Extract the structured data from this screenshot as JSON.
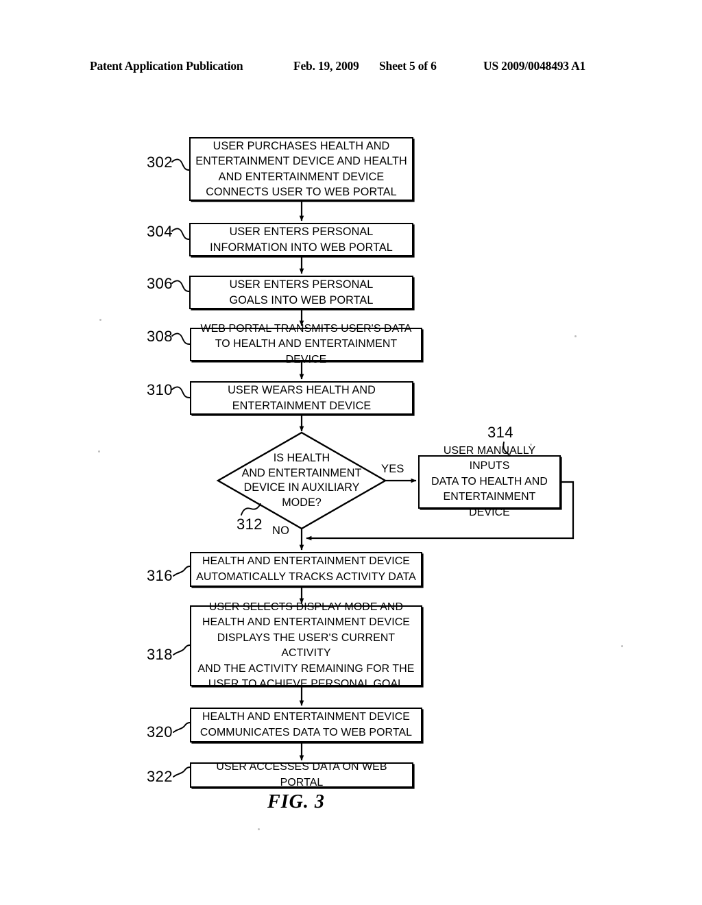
{
  "header": {
    "publication": "Patent Application Publication",
    "date": "Feb. 19, 2009",
    "sheet": "Sheet 5 of 6",
    "patent_number": "US 2009/0048493 A1"
  },
  "figure": {
    "caption": "FIG. 3",
    "ink_color": "#000000",
    "background_color": "#ffffff"
  },
  "flowchart": {
    "nodes": [
      {
        "ref": "302",
        "shape": "process",
        "text": "USER PURCHASES HEALTH AND\nENTERTAINMENT DEVICE AND HEALTH\nAND ENTERTAINMENT DEVICE\nCONNECTS USER TO WEB PORTAL"
      },
      {
        "ref": "304",
        "shape": "process",
        "text": "USER ENTERS PERSONAL\nINFORMATION INTO WEB PORTAL"
      },
      {
        "ref": "306",
        "shape": "process",
        "text": "USER ENTERS PERSONAL\nGOALS INTO WEB PORTAL"
      },
      {
        "ref": "308",
        "shape": "process",
        "text": "WEB PORTAL TRANSMITS USER'S DATA\nTO HEALTH AND ENTERTAINMENT DEVICE"
      },
      {
        "ref": "310",
        "shape": "process",
        "text": "USER WEARS HEALTH AND\nENTERTAINMENT DEVICE"
      },
      {
        "ref": "312",
        "shape": "decision",
        "text": "IS HEALTH\nAND ENTERTAINMENT\nDEVICE IN AUXILIARY\nMODE?"
      },
      {
        "ref": "314",
        "shape": "process",
        "text": "USER MANUALLY INPUTS\nDATA TO HEALTH AND\nENTERTAINMENT DEVICE"
      },
      {
        "ref": "316",
        "shape": "process",
        "text": "HEALTH AND ENTERTAINMENT DEVICE\nAUTOMATICALLY TRACKS ACTIVITY DATA"
      },
      {
        "ref": "318",
        "shape": "process",
        "text": "USER SELECTS DISPLAY MODE AND\nHEALTH AND ENTERTAINMENT DEVICE\nDISPLAYS THE USER'S CURRENT ACTIVITY\nAND THE ACTIVITY REMAINING FOR THE\nUSER TO ACHIEVE PERSONAL GOAL"
      },
      {
        "ref": "320",
        "shape": "process",
        "text": "HEALTH AND ENTERTAINMENT DEVICE\nCOMMUNICATES DATA TO WEB PORTAL"
      },
      {
        "ref": "322",
        "shape": "process",
        "text": "USER ACCESSES DATA ON WEB PORTAL"
      }
    ],
    "branch_labels": {
      "yes": "YES",
      "no": "NO"
    },
    "edges": [
      {
        "from": "302",
        "to": "304",
        "label": ""
      },
      {
        "from": "304",
        "to": "306",
        "label": ""
      },
      {
        "from": "306",
        "to": "308",
        "label": ""
      },
      {
        "from": "308",
        "to": "310",
        "label": ""
      },
      {
        "from": "310",
        "to": "312",
        "label": ""
      },
      {
        "from": "312",
        "to": "314",
        "label": "YES"
      },
      {
        "from": "312",
        "to": "316",
        "label": "NO"
      },
      {
        "from": "314",
        "to": "316",
        "label": ""
      },
      {
        "from": "316",
        "to": "318",
        "label": ""
      },
      {
        "from": "318",
        "to": "320",
        "label": ""
      },
      {
        "from": "320",
        "to": "322",
        "label": ""
      }
    ]
  }
}
